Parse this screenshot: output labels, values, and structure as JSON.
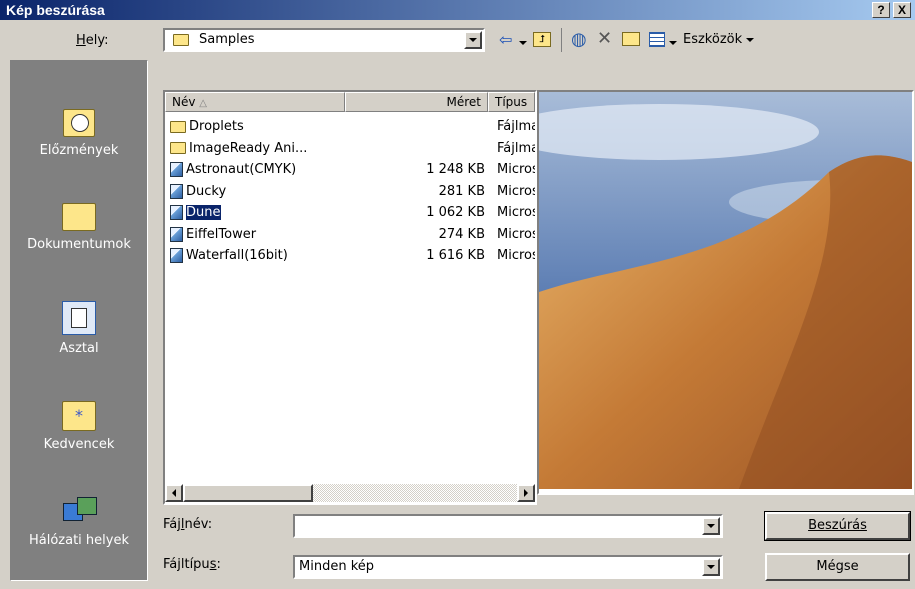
{
  "window": {
    "title": "Kép beszúrása",
    "help_btn": "?",
    "close_btn": "X"
  },
  "location": {
    "label": "Hely:",
    "value": "Samples"
  },
  "toolbar": {
    "tools_label": "Eszközök"
  },
  "places": [
    {
      "label": "Előzmények",
      "icon": "history-icon"
    },
    {
      "label": "Dokumentumok",
      "icon": "documents-folder-icon"
    },
    {
      "label": "Asztal",
      "icon": "desktop-icon"
    },
    {
      "label": "Kedvencek",
      "icon": "favorites-folder-icon"
    },
    {
      "label": "Hálózati helyek",
      "icon": "network-places-icon"
    }
  ],
  "columns": {
    "name": "Név",
    "size": "Méret",
    "type": "Típus"
  },
  "files": [
    {
      "name": "Droplets",
      "size": "",
      "type": "Fájlmappa",
      "kind": "folder"
    },
    {
      "name": "ImageReady Ani...",
      "size": "",
      "type": "Fájlmappa",
      "kind": "folder"
    },
    {
      "name": "Astronaut(CMYK)",
      "size": "1 248 KB",
      "type": "Microsoft",
      "kind": "image"
    },
    {
      "name": "Ducky",
      "size": "281 KB",
      "type": "Microsoft",
      "kind": "image"
    },
    {
      "name": "Dune",
      "size": "1 062 KB",
      "type": "Microsoft",
      "kind": "image",
      "selected": true
    },
    {
      "name": "EiffelTower",
      "size": "274 KB",
      "type": "Microsoft",
      "kind": "image"
    },
    {
      "name": "Waterfall(16bit)",
      "size": "1 616 KB",
      "type": "Microsoft",
      "kind": "image"
    }
  ],
  "filename": {
    "label": "Fájlnév:",
    "value": ""
  },
  "filetype": {
    "label": "Fájltípus:",
    "value": "Minden kép"
  },
  "buttons": {
    "insert": "Beszúrás",
    "cancel": "Mégse"
  },
  "colors": {
    "titlebar_start": "#0a246a",
    "titlebar_end": "#a6caf0",
    "selection": "#0a246a",
    "face": "#d4d0c8"
  }
}
